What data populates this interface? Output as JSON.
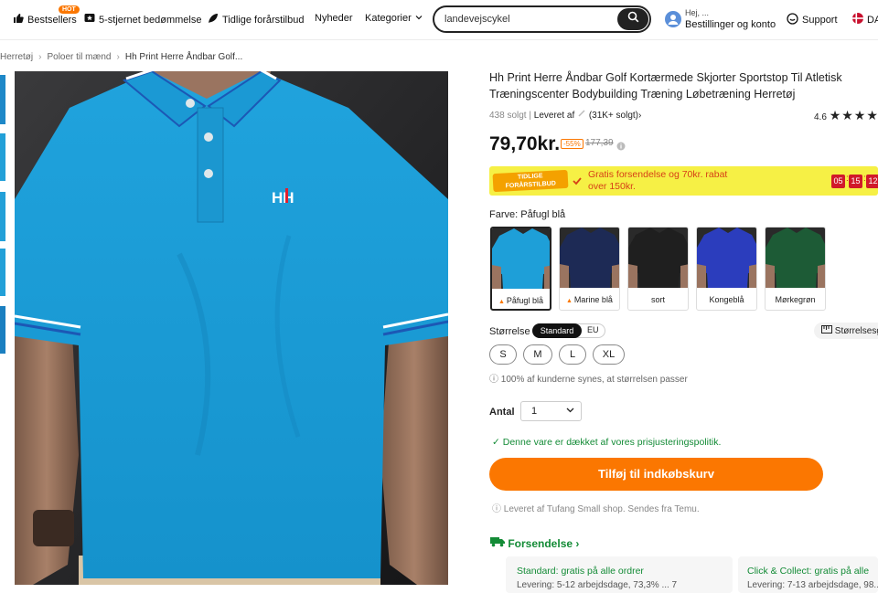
{
  "topbar": {
    "bestsellers": "Bestsellers",
    "hot_badge": "HOT",
    "rating_link": "5-stjernet bedømmelse",
    "early_deals": "Tidlige forårstilbud",
    "news": "Nyheder",
    "categories": "Kategorier",
    "search_value": "landevejscykel",
    "account_greeting": "Hej, ...",
    "account_label": "Bestillinger og konto",
    "support": "Support",
    "language": "DA"
  },
  "breadcrumb": [
    "Herretøj",
    "Poloer til mænd",
    "Hh Print Herre Åndbar Golf..."
  ],
  "product": {
    "title": "Hh Print Herre Åndbar Golf Kortærmede Skjorter Sportstop Til Atletisk Træningscenter Bodybuilding Træning Løbetræning Herretøj",
    "sold": "438 solgt",
    "delivered_by": "Leveret af",
    "seller_sold": "(31K+ solgt)",
    "rating": "4.6",
    "price": "79,70kr.",
    "discount": "-55%",
    "old_price": "177,39",
    "logo_text": "HH"
  },
  "promo": {
    "badge": "TIDLIGE FORÅRSTILBUD",
    "text": "Gratis forsendelse og 70kr. rabat over 150kr.",
    "timer": [
      "05",
      "15",
      "12"
    ]
  },
  "colors": {
    "label": "Farve: Påfugl blå",
    "options": [
      {
        "name": "Påfugl blå",
        "color": "#1e9fd8",
        "hot": true
      },
      {
        "name": "Marine blå",
        "color": "#1d2a55",
        "hot": true
      },
      {
        "name": "sort",
        "color": "#1f1f1f",
        "hot": false
      },
      {
        "name": "Kongeblå",
        "color": "#2b3dbd",
        "hot": false
      },
      {
        "name": "Mørkegrøn",
        "color": "#1d5b36",
        "hot": false
      }
    ]
  },
  "size": {
    "label": "Størrelse",
    "standard": "Standard",
    "eu": "EU",
    "guide": "Størrelsesg",
    "options": [
      "S",
      "M",
      "L",
      "XL"
    ],
    "fit_note": "100% af kunderne synes, at størrelsen passer"
  },
  "quantity": {
    "label": "Antal",
    "value": "1"
  },
  "price_policy": "Denne vare er dækket af vores prisjusteringspolitik.",
  "cart_button": "Tilføj til indkøbskurv",
  "ship_from": "Leveret af Tufang Small shop. Sendes fra Temu.",
  "shipping": {
    "title": "Forsendelse",
    "standard_label": "Standard:",
    "standard_value": "gratis på alle ordrer",
    "standard_detail": "Levering: 5-12 arbejdsdage, 73,3% ... 7",
    "click_label": "Click & Collect:",
    "click_value": "gratis på alle",
    "click_detail": "Levering: 7-13 arbejdsdage, 98..."
  }
}
